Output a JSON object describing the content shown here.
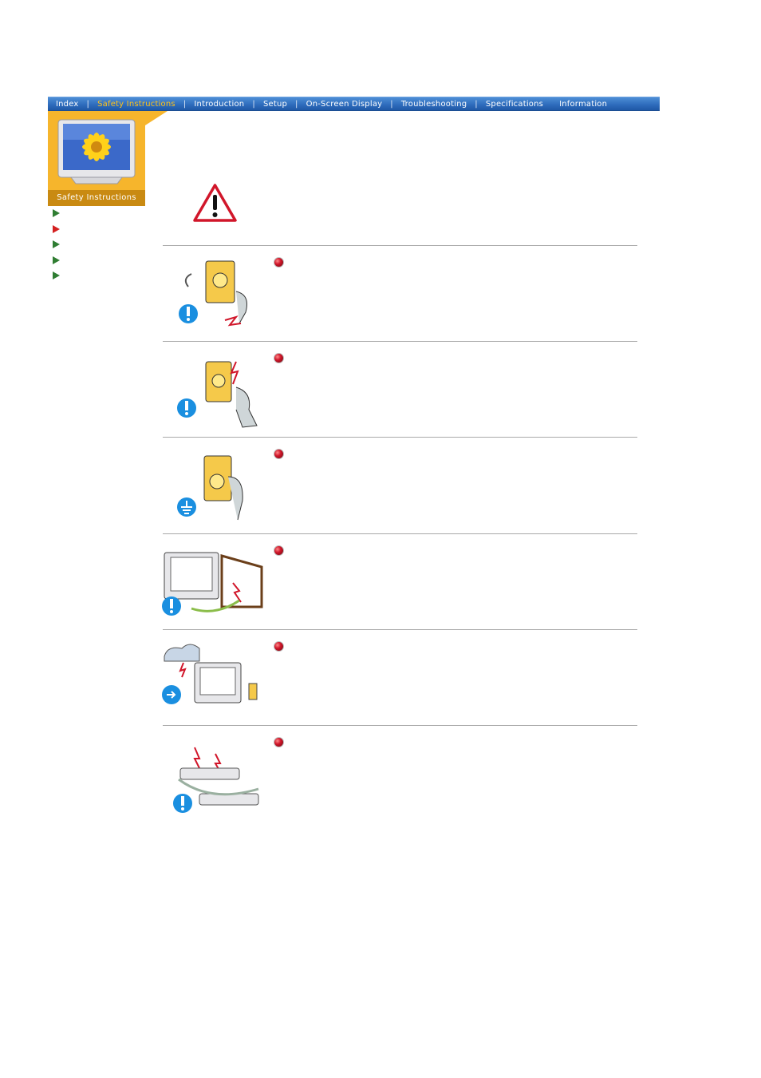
{
  "nav": {
    "items": [
      {
        "label": "Index",
        "active": false
      },
      {
        "label": "Safety Instructions",
        "active": true
      },
      {
        "label": "Introduction",
        "active": false
      },
      {
        "label": "Setup",
        "active": false
      },
      {
        "label": "On-Screen Display",
        "active": false
      },
      {
        "label": "Troubleshooting",
        "active": false
      },
      {
        "label": "Specifications",
        "active": false
      },
      {
        "label": "Information",
        "active": false
      }
    ],
    "separator": "|",
    "active_color": "#ffc21a",
    "bar_color": "#2f6dbd"
  },
  "side": {
    "caption": "Safety Instructions",
    "panel_color": "#f6b52c",
    "arrows": [
      {
        "icon": "green-arrow-icon",
        "active": false
      },
      {
        "icon": "red-arrow-icon",
        "active": true
      },
      {
        "icon": "green-arrow-icon",
        "active": false
      },
      {
        "icon": "green-arrow-icon",
        "active": false
      },
      {
        "icon": "green-arrow-icon",
        "active": false
      }
    ]
  },
  "main": {
    "warning_icon": "warning-triangle-icon",
    "items": [
      {
        "illustration": "plug-outlet-unplug-illustration",
        "badge": "exclamation-icon",
        "bullet": "red-bullet-icon"
      },
      {
        "illustration": "wet-hand-plug-illustration",
        "badge": "exclamation-icon",
        "bullet": "red-bullet-icon"
      },
      {
        "illustration": "grounded-outlet-illustration",
        "badge": "ground-icon",
        "bullet": "red-bullet-icon"
      },
      {
        "illustration": "monitor-bent-cord-illustration",
        "badge": "exclamation-icon",
        "bullet": "red-bullet-icon"
      },
      {
        "illustration": "monitor-lightning-storm-illustration",
        "badge": "unplug-icon",
        "bullet": "red-bullet-icon"
      },
      {
        "illustration": "overloaded-power-strip-illustration",
        "badge": "exclamation-icon",
        "bullet": "red-bullet-icon"
      }
    ]
  }
}
